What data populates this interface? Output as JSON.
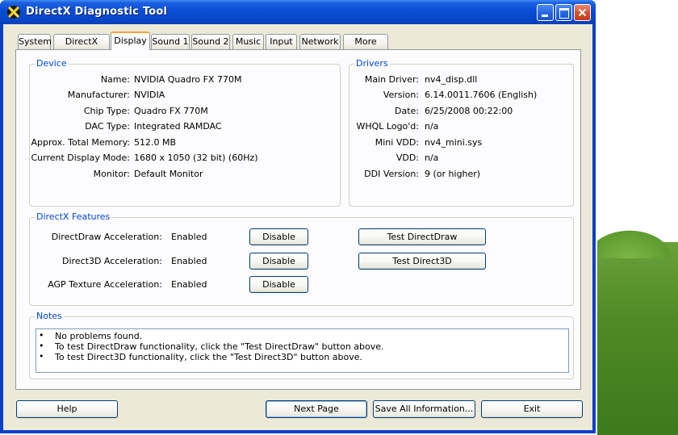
{
  "window": {
    "title": "DirectX Diagnostic Tool"
  },
  "tabs": [
    "System",
    "DirectX Files",
    "Display",
    "Sound 1",
    "Sound 2",
    "Music",
    "Input",
    "Network",
    "More Help"
  ],
  "active_tab": "Display",
  "device": {
    "legend": "Device",
    "rows": [
      {
        "label": "Name:",
        "value": "NVIDIA Quadro FX 770M"
      },
      {
        "label": "Manufacturer:",
        "value": "NVIDIA"
      },
      {
        "label": "Chip Type:",
        "value": "Quadro FX 770M"
      },
      {
        "label": "DAC Type:",
        "value": "Integrated RAMDAC"
      },
      {
        "label": "Approx. Total Memory:",
        "value": "512.0 MB"
      },
      {
        "label": "Current Display Mode:",
        "value": "1680 x 1050 (32 bit) (60Hz)"
      },
      {
        "label": "Monitor:",
        "value": "Default Monitor"
      }
    ]
  },
  "drivers": {
    "legend": "Drivers",
    "rows": [
      {
        "label": "Main Driver:",
        "value": "nv4_disp.dll"
      },
      {
        "label": "Version:",
        "value": "6.14.0011.7606 (English)"
      },
      {
        "label": "Date:",
        "value": "6/25/2008 00:22:00"
      },
      {
        "label": "WHQL Logo'd:",
        "value": "n/a"
      },
      {
        "label": "Mini VDD:",
        "value": "nv4_mini.sys"
      },
      {
        "label": "VDD:",
        "value": "n/a"
      },
      {
        "label": "DDI Version:",
        "value": "9 (or higher)"
      }
    ]
  },
  "features": {
    "legend": "DirectX Features",
    "rows": [
      {
        "label": "DirectDraw Acceleration:",
        "value": "Enabled",
        "button": "Disable",
        "test": "Test DirectDraw"
      },
      {
        "label": "Direct3D Acceleration:",
        "value": "Enabled",
        "button": "Disable",
        "test": "Test Direct3D"
      },
      {
        "label": "AGP Texture Acceleration:",
        "value": "Enabled",
        "button": "Disable"
      }
    ]
  },
  "notes": {
    "legend": "Notes",
    "bullet": "•",
    "lines": [
      "No problems found.",
      "To test DirectDraw functionality, click the \"Test DirectDraw\" button above.",
      "To test Direct3D functionality, click the \"Test Direct3D\" button above."
    ]
  },
  "footer": {
    "help": "Help",
    "next": "Next Page",
    "save": "Save All Information...",
    "exit": "Exit"
  },
  "colors": {
    "title_bar": "#0a4fd8",
    "group_legend": "#0046d5",
    "dialog_bg": "#ece9d8"
  }
}
